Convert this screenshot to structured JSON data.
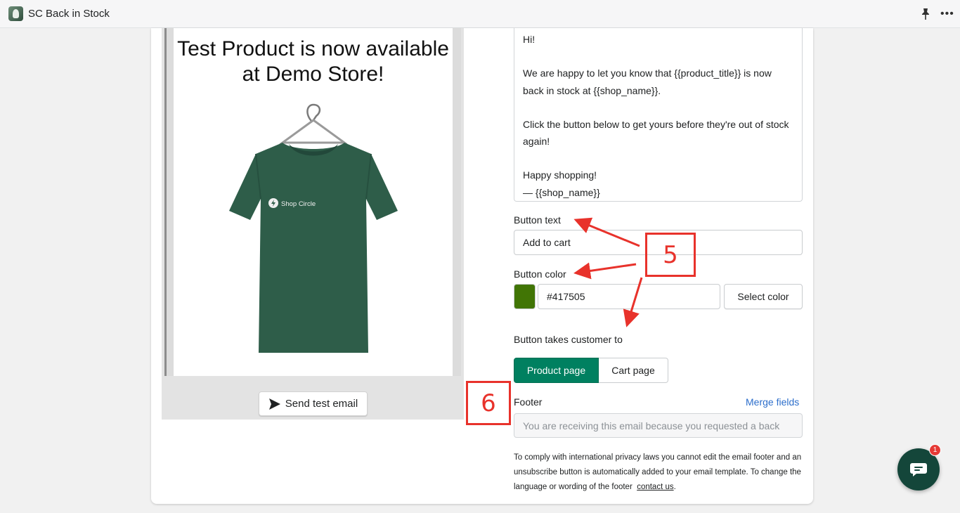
{
  "app": {
    "title": "SC Back in Stock",
    "logo_icon": "app-logo-icon",
    "pin_icon": "pin-icon",
    "more_label": "•••"
  },
  "preview": {
    "heading": "Test Product is now available at Demo Store!",
    "shirt_brand": "Shop Circle",
    "send_button": "Send test email"
  },
  "email_body": {
    "lines": [
      "Hi!",
      "",
      "We are happy to let you know that {{product_title}} is now back in stock at {{shop_name}}.",
      "",
      "Click the button below to get yours before they're out of stock again!",
      "",
      "Happy shopping!",
      "— {{shop_name}}"
    ]
  },
  "button_text": {
    "label": "Button text",
    "value": "Add to cart"
  },
  "button_color": {
    "label": "Button color",
    "value": "#417505",
    "swatch_color": "#417505",
    "select_label": "Select color"
  },
  "destination": {
    "label": "Button takes customer to",
    "options": [
      "Product page",
      "Cart page"
    ],
    "selected": "Product page"
  },
  "footer": {
    "label": "Footer",
    "merge_link": "Merge fields",
    "placeholder": "You are receiving this email because you requested a back",
    "note_1": "To comply with international privacy laws you cannot edit the email footer and an unsubscribe button is automatically added to your email template.",
    "note_2": "To change the language or wording of the footer",
    "note_link": "contact us",
    "note_end": "."
  },
  "annotations": {
    "step_5": "5",
    "step_6": "6",
    "color": "#e8322b"
  },
  "chat": {
    "badge_count": "1"
  }
}
